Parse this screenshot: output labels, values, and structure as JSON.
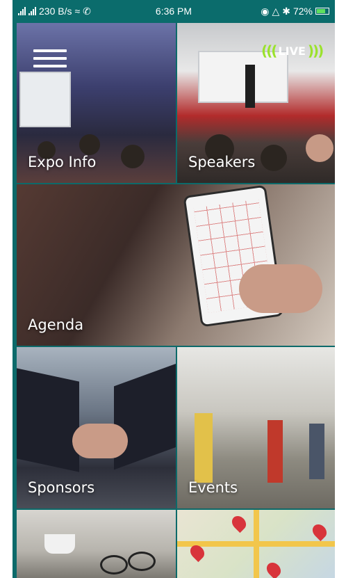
{
  "status_bar": {
    "network_speed": "230 B/s",
    "time": "6:36 PM",
    "battery": "72%",
    "battery_level": 0.72
  },
  "header": {
    "menu_icon": "hamburger-menu-icon",
    "live_badge": "LIVE",
    "live_icon": "broadcast-waves-icon",
    "live_color": "#9be22d"
  },
  "tiles": [
    {
      "label": "Expo Info"
    },
    {
      "label": "Speakers"
    },
    {
      "label": "Agenda"
    },
    {
      "label": "Sponsors"
    },
    {
      "label": "Events"
    },
    {
      "label": ""
    },
    {
      "label": ""
    }
  ],
  "colors": {
    "status_bar_bg": "#0b6c6c",
    "label_text": "#ffffff"
  }
}
